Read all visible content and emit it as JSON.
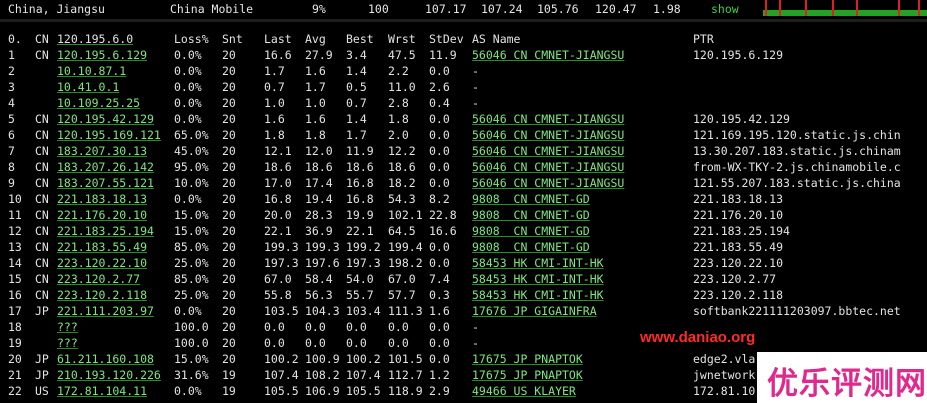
{
  "top": {
    "location": "China, Jiangsu",
    "isp": "China Mobile",
    "loss": "9%",
    "snt": "100",
    "last": "107.17",
    "avg": "107.24",
    "best": "105.76",
    "wrst": "120.47",
    "stdev": "1.98",
    "show": "show"
  },
  "header": {
    "hop": "0.",
    "cc": "CN",
    "ip": "120.195.6.0",
    "loss": "Loss%",
    "snt": "Snt",
    "last": "Last",
    "avg": "Avg",
    "best": "Best",
    "wrst": "Wrst",
    "stdev": "StDev",
    "asname": "AS Name",
    "ptr": "PTR"
  },
  "hops": [
    {
      "hop": "1",
      "cc": "CN",
      "ip": "120.195.6.129",
      "loss": "0.0%",
      "snt": "20",
      "last": "16.6",
      "avg": "27.9",
      "best": "3.4",
      "wrst": "47.5",
      "stdev": "11.9",
      "as": "56046 CN CMNET-JIANGSU",
      "ptr": "120.195.6.129"
    },
    {
      "hop": "2",
      "cc": "",
      "ip": "10.10.87.1",
      "loss": "0.0%",
      "snt": "20",
      "last": "1.7",
      "avg": "1.6",
      "best": "1.4",
      "wrst": "2.2",
      "stdev": "0.0",
      "as": "-",
      "ptr": ""
    },
    {
      "hop": "3",
      "cc": "",
      "ip": "10.41.0.1",
      "loss": "0.0%",
      "snt": "20",
      "last": "0.7",
      "avg": "1.7",
      "best": "0.5",
      "wrst": "11.0",
      "stdev": "2.6",
      "as": "-",
      "ptr": ""
    },
    {
      "hop": "4",
      "cc": "",
      "ip": "10.109.25.25",
      "loss": "0.0%",
      "snt": "20",
      "last": "1.0",
      "avg": "1.0",
      "best": "0.7",
      "wrst": "2.8",
      "stdev": "0.4",
      "as": "-",
      "ptr": ""
    },
    {
      "hop": "5",
      "cc": "CN",
      "ip": "120.195.42.129",
      "loss": "0.0%",
      "snt": "20",
      "last": "1.6",
      "avg": "1.6",
      "best": "1.4",
      "wrst": "1.8",
      "stdev": "0.0",
      "as": "56046 CN CMNET-JIANGSU",
      "ptr": "120.195.42.129"
    },
    {
      "hop": "6",
      "cc": "CN",
      "ip": "120.195.169.121",
      "loss": "65.0%",
      "snt": "20",
      "last": "1.8",
      "avg": "1.8",
      "best": "1.7",
      "wrst": "2.0",
      "stdev": "0.0",
      "as": "56046 CN CMNET-JIANGSU",
      "ptr": "121.169.195.120.static.js.chin"
    },
    {
      "hop": "7",
      "cc": "CN",
      "ip": "183.207.30.13",
      "loss": "45.0%",
      "snt": "20",
      "last": "12.1",
      "avg": "12.0",
      "best": "11.9",
      "wrst": "12.2",
      "stdev": "0.0",
      "as": "56046 CN CMNET-JIANGSU",
      "ptr": "13.30.207.183.static.js.chinam"
    },
    {
      "hop": "8",
      "cc": "CN",
      "ip": "183.207.26.142",
      "loss": "95.0%",
      "snt": "20",
      "last": "18.6",
      "avg": "18.6",
      "best": "18.6",
      "wrst": "18.6",
      "stdev": "0.0",
      "as": "56046 CN CMNET-JIANGSU",
      "ptr": "from-WX-TKY-2.js.chinamobile.c"
    },
    {
      "hop": "9",
      "cc": "CN",
      "ip": "183.207.55.121",
      "loss": "10.0%",
      "snt": "20",
      "last": "17.0",
      "avg": "17.4",
      "best": "16.8",
      "wrst": "18.2",
      "stdev": "0.0",
      "as": "56046 CN CMNET-JIANGSU",
      "ptr": "121.55.207.183.static.js.china"
    },
    {
      "hop": "10",
      "cc": "CN",
      "ip": "221.183.18.13",
      "loss": "0.0%",
      "snt": "20",
      "last": "16.8",
      "avg": "19.4",
      "best": "16.8",
      "wrst": "54.3",
      "stdev": "8.2",
      "as": "9808  CN CMNET-GD",
      "ptr": "221.183.18.13"
    },
    {
      "hop": "11",
      "cc": "CN",
      "ip": "221.176.20.10",
      "loss": "15.0%",
      "snt": "20",
      "last": "20.0",
      "avg": "28.3",
      "best": "19.9",
      "wrst": "102.1",
      "stdev": "22.8",
      "as": "9808  CN CMNET-GD",
      "ptr": "221.176.20.10"
    },
    {
      "hop": "12",
      "cc": "CN",
      "ip": "221.183.25.194",
      "loss": "15.0%",
      "snt": "20",
      "last": "22.1",
      "avg": "36.9",
      "best": "22.1",
      "wrst": "64.5",
      "stdev": "16.6",
      "as": "9808  CN CMNET-GD",
      "ptr": "221.183.25.194"
    },
    {
      "hop": "13",
      "cc": "CN",
      "ip": "221.183.55.49",
      "loss": "85.0%",
      "snt": "20",
      "last": "199.3",
      "avg": "199.3",
      "best": "199.2",
      "wrst": "199.4",
      "stdev": "0.0",
      "as": "9808  CN CMNET-GD",
      "ptr": "221.183.55.49"
    },
    {
      "hop": "14",
      "cc": "CN",
      "ip": "223.120.22.10",
      "loss": "25.0%",
      "snt": "20",
      "last": "197.3",
      "avg": "197.6",
      "best": "197.3",
      "wrst": "198.2",
      "stdev": "0.0",
      "as": "58453 HK CMI-INT-HK",
      "ptr": "223.120.22.10"
    },
    {
      "hop": "15",
      "cc": "CN",
      "ip": "223.120.2.77",
      "loss": "85.0%",
      "snt": "20",
      "last": "67.0",
      "avg": "58.4",
      "best": "54.0",
      "wrst": "67.0",
      "stdev": "7.4",
      "as": "58453 HK CMI-INT-HK",
      "ptr": "223.120.2.77"
    },
    {
      "hop": "16",
      "cc": "CN",
      "ip": "223.120.2.118",
      "loss": "25.0%",
      "snt": "20",
      "last": "55.8",
      "avg": "56.3",
      "best": "55.7",
      "wrst": "57.7",
      "stdev": "0.3",
      "as": "58453 HK CMI-INT-HK",
      "ptr": "223.120.2.118"
    },
    {
      "hop": "17",
      "cc": "JP",
      "ip": "221.111.203.97",
      "loss": "0.0%",
      "snt": "20",
      "last": "103.5",
      "avg": "104.3",
      "best": "103.4",
      "wrst": "111.3",
      "stdev": "1.6",
      "as": "17676 JP GIGAINFRA",
      "ptr": "softbank221111203097.bbtec.net"
    },
    {
      "hop": "18",
      "cc": "",
      "ip": "???",
      "loss": "100.0",
      "snt": "20",
      "last": "0.0",
      "avg": "0.0",
      "best": "0.0",
      "wrst": "0.0",
      "stdev": "0.0",
      "as": "-",
      "ptr": ""
    },
    {
      "hop": "19",
      "cc": "",
      "ip": "???",
      "loss": "100.0",
      "snt": "20",
      "last": "0.0",
      "avg": "0.0",
      "best": "0.0",
      "wrst": "0.0",
      "stdev": "0.0",
      "as": "-",
      "ptr": ""
    },
    {
      "hop": "20",
      "cc": "JP",
      "ip": "61.211.160.108",
      "loss": "15.0%",
      "snt": "20",
      "last": "100.2",
      "avg": "100.9",
      "best": "100.2",
      "wrst": "101.5",
      "stdev": "0.0",
      "as": "17675 JP PNAPTOK",
      "ptr": "edge2.vla"
    },
    {
      "hop": "21",
      "cc": "JP",
      "ip": "210.193.120.226",
      "loss": "31.6%",
      "snt": "19",
      "last": "107.4",
      "avg": "108.2",
      "best": "107.4",
      "wrst": "112.7",
      "stdev": "1.2",
      "as": "17675 JP PNAPTOK",
      "ptr": "jwnetwork"
    },
    {
      "hop": "22",
      "cc": "US",
      "ip": "172.81.104.11",
      "loss": "0.0%",
      "snt": "19",
      "last": "105.5",
      "avg": "106.9",
      "best": "105.5",
      "wrst": "118.9",
      "stdev": "2.9",
      "as": "49466 US KLAYER",
      "ptr": "172.81.10"
    }
  ],
  "watermark": {
    "url": "www.daniao.org",
    "logo_text": "优乐评测网"
  },
  "colors": {
    "background": "#000000",
    "text": "#e3e3e3",
    "ip": "#7ce87c",
    "watermark_url": "#ff2a2a",
    "logo": "#e0298e"
  }
}
